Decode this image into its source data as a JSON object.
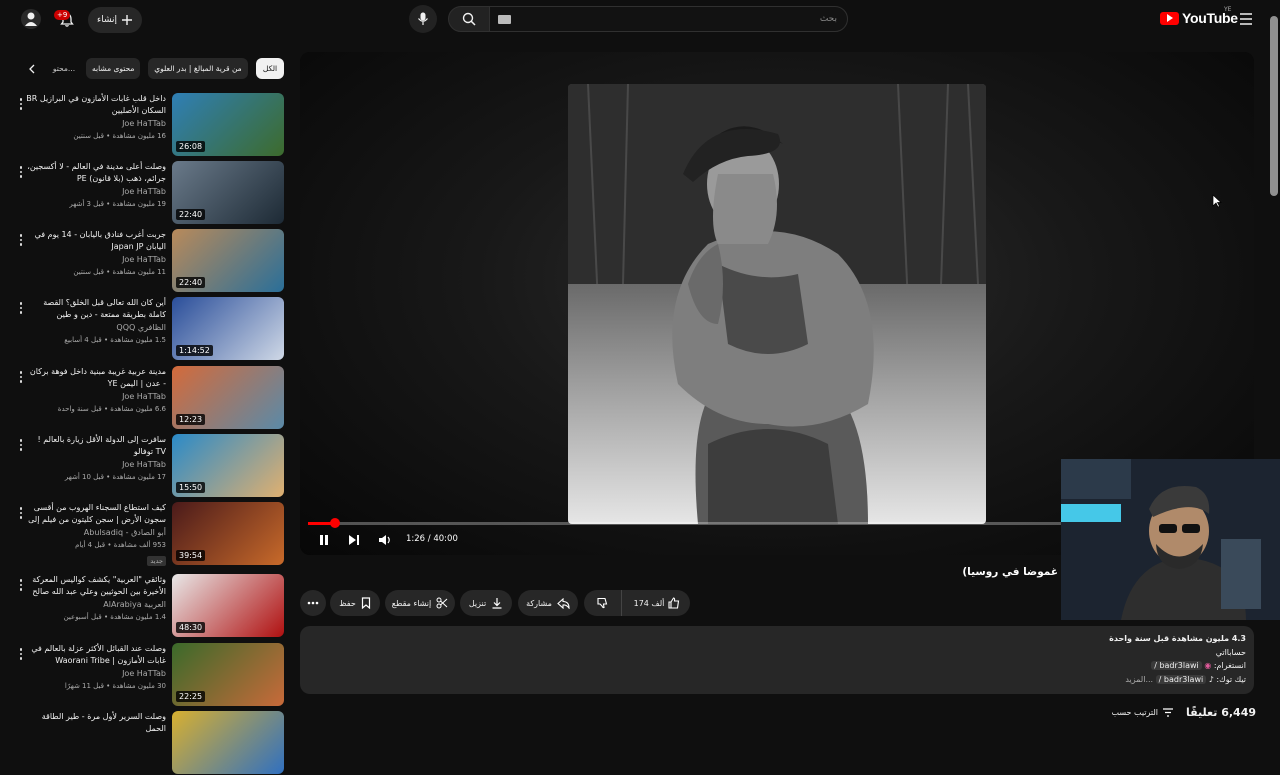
{
  "header": {
    "logo_text": "YouTube",
    "country_code": "YE",
    "search_placeholder": "بحث",
    "create_label": "إنشاء",
    "notification_count": "+9"
  },
  "chips": [
    {
      "label": "الكل",
      "active": true
    },
    {
      "label": "من قرية المبالغ | بدر العلوي",
      "active": false
    },
    {
      "label": "محتوى مشابه",
      "active": false
    },
    {
      "label": "محتو...",
      "active": false
    }
  ],
  "videos": [
    {
      "title": "داخل قلب غابات الأمازون في البرازيل BR السكان الأصليين",
      "channel": "Joe HaTTab",
      "meta": "16 مليون مشاهدة • قبل سنتين",
      "duration": "26:08",
      "c1": "#2f7fb6",
      "c2": "#3d6b2c"
    },
    {
      "title": "وصلت أعلى مدينة في العالم - لا أكسجين، جرائم، ذهب (بلا قانون) PE",
      "channel": "Joe HaTTab",
      "meta": "19 مليون مشاهدة • قبل 3 أشهر",
      "duration": "22:40",
      "c1": "#6a7a8a",
      "c2": "#1d2a35"
    },
    {
      "title": "جربت أغرب فنادق باليابان - 14 يوم في اليابان Japan JP",
      "channel": "Joe HaTTab",
      "meta": "11 مليون مشاهدة • قبل سنتين",
      "duration": "22:40",
      "c1": "#b98a5a",
      "c2": "#2a6f99"
    },
    {
      "title": "أين كان الله تعالى قبل الخلق؟ القصة كاملة بطريقة ممتعة - دين و طين",
      "channel": "الظافري QQQ",
      "meta": "1.5 مليون مشاهدة • قبل 4 أسابيع",
      "duration": "1:14:52",
      "c1": "#2a4e9a",
      "c2": "#cfd8e6"
    },
    {
      "title": "مدينة عربية غريبة مبنية داخل فوهة بركان - عدن | اليمن YE",
      "channel": "Joe HaTTab",
      "meta": "6.6 مليون مشاهدة • قبل سنة واحدة",
      "duration": "12:23",
      "c1": "#d46a3a",
      "c2": "#5a8aa8"
    },
    {
      "title": "سافرت إلى الدولة الأقل زيارة بالعالم ! TV توفالو",
      "channel": "Joe HaTTab",
      "meta": "17 مليون مشاهدة • قبل 10 أشهر",
      "duration": "15:50",
      "c1": "#2a8ac8",
      "c2": "#e0b070"
    },
    {
      "title": "كيف استطاع السجناء الهروب من أقسى سجون الأرض | سجن كليتون من فيلم إلى حقيقة",
      "channel": "أبو الصادق - Abulsadiq",
      "meta": "953 ألف مشاهدة • قبل 4 أيام",
      "tag": "جديد",
      "duration": "39:54",
      "c1": "#4a1a1a",
      "c2": "#c86a2a"
    },
    {
      "title": "وثائقي \"العربية\" يكشف كواليس المعركة الأخيرة بين الحوثيين وعلي عبد الله صالح",
      "channel": "العربية AlArabiya",
      "meta": "1.4 مليون مشاهدة • قبل أسبوعين",
      "duration": "48:30",
      "c1": "#e8e8e8",
      "c2": "#b01010"
    },
    {
      "title": "وصلت عند القبائل الأكثر عزلة بالعالم في غابات الأمازون | Waorani Tribe",
      "channel": "Joe HaTTab",
      "meta": "30 مليون مشاهدة • قبل 11 شهرًا",
      "duration": "22:25",
      "c1": "#3a6a2a",
      "c2": "#c86a3a"
    },
    {
      "title": "وصلت السرير لأول مرة - طير الطاقة الحمل",
      "channel": "",
      "meta": "",
      "duration": "",
      "c1": "#d8b030",
      "c2": "#3070c0"
    }
  ],
  "player": {
    "time_display": "1:26 / 40:00",
    "progress": 0.0358,
    "video_title": "غموضا في روسيا)"
  },
  "actions": {
    "likes": "174 ألف",
    "share": "مشاركة",
    "download": "تنزيل",
    "clip": "إنشاء مقطع",
    "save": "حفظ"
  },
  "description": {
    "views_line": "4.3 مليون مشاهدة قبل سنة واحدة",
    "line2": "حسابااتي",
    "instagram": "badr3lawi /",
    "instagram_label": "انستغرام:",
    "tiktok": "badr3lawi /",
    "tiktok_label": "تيك توك:",
    "more": "...المزيد"
  },
  "comments": {
    "count": "6,449 تعليقًا",
    "sort_label": "الترتيب حسب"
  }
}
